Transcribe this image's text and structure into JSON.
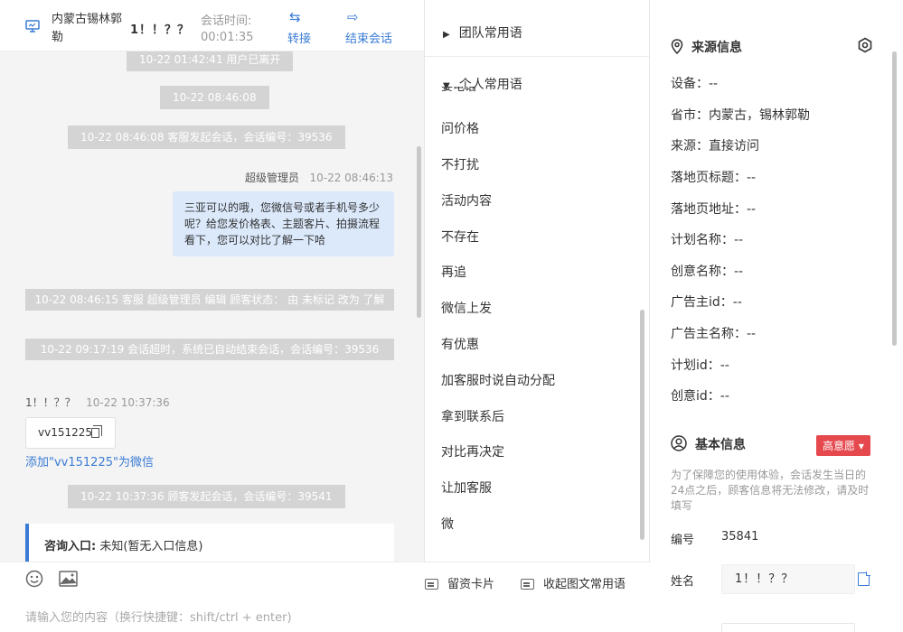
{
  "header": {
    "location": "内蒙古锡林郭勒",
    "visitor_name": "1！！？？",
    "session_label": "会话时间:",
    "session_time": "00:01:35",
    "transfer_label": "转接",
    "end_label": "结束会话"
  },
  "chat": {
    "sys_left": "10-22 01:42:41 用户已离开",
    "time_divider": "10-22 08:46:08",
    "sys_start_1": "10-22 08:46:08 客服发起会话，会话编号：39536",
    "agent_name": "超级管理员",
    "agent_time": "10-22 08:46:13",
    "agent_msg": "三亚可以的哦，您微信号或者手机号多少呢？给您发价格表、主题客片、拍摄流程看下，您可以对比了解一下哈",
    "sys_edit": "10-22 08:46:15 客服 超级管理员 编辑 顾客状态： 由 未标记 改为 了解",
    "sys_timeout": "10-22 09:17:19 会话超时，系统已自动结束会话，会话编号：39536",
    "visitor_name": "1！！？？",
    "visitor_time": "10-22 10:37:36",
    "wechat_id": "vv151225",
    "add_wechat": "添加\"vv151225\"为微信",
    "sys_start_2": "10-22 10:37:36 顾客发起会话，会话编号：39541",
    "entry_label": "咨询入口:",
    "entry_value": "未知(暂无入口信息)"
  },
  "input": {
    "placeholder": "请输入您的内容（换行快捷键：shift/ctrl + enter)",
    "card_btn": "留资卡片",
    "collapse_btn": "收起图文常用语"
  },
  "phrases": {
    "team_group": "团队常用语",
    "personal_group": "个人常用语",
    "clipped_item": "要电话",
    "items": [
      "问价格",
      "不打扰",
      "活动内容",
      "不存在",
      "再追",
      "微信上发",
      "有优惠",
      "加客服时说自动分配",
      "拿到联系后",
      "对比再决定",
      "让加客服",
      "微"
    ]
  },
  "info": {
    "source_title": "来源信息",
    "device": "设备：--",
    "province": "省市：内蒙古，锡林郭勒",
    "source": "来源：直接访问",
    "landing_title": "落地页标题：--",
    "landing_url": "落地页地址：--",
    "plan_name": "计划名称：--",
    "creative_name": "创意名称：--",
    "advertiser_id": "广告主id：--",
    "advertiser_name": "广告主名称：--",
    "plan_id": "计划id：--",
    "creative_id": "创意id：--",
    "basic_title": "基本信息",
    "intent_badge": "高意愿 ▾",
    "notice": "为了保障您的使用体验，会话发生当日的24点之后，顾客信息将无法修改，请及时填写",
    "id_label": "编号",
    "id_value": "35841",
    "name_label": "姓名",
    "name_value": "1！！？？"
  },
  "colors": {
    "accent": "#3a7bd5",
    "badge": "#e5484d",
    "bubble": "#dbe9fb",
    "system_pill": "#d4d4d4"
  }
}
